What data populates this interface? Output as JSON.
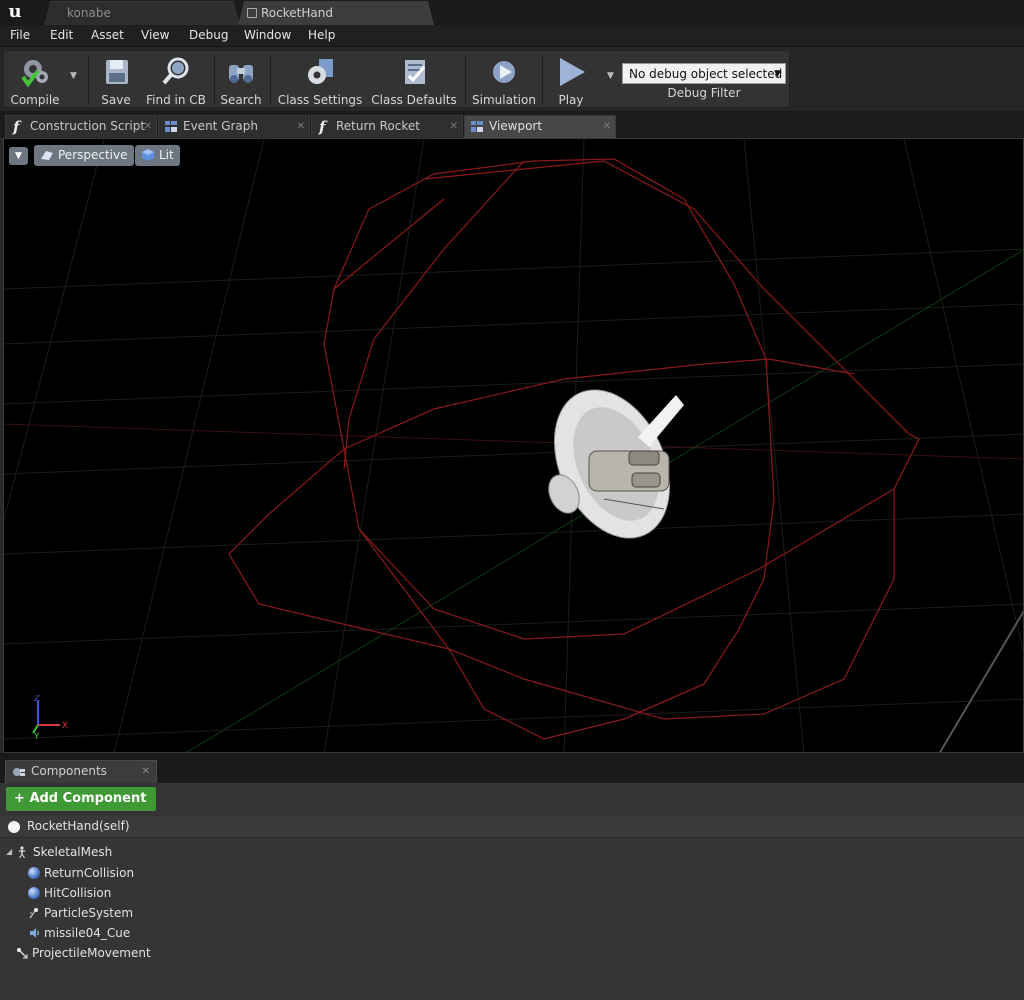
{
  "doc_tabs": [
    {
      "label": "konabe",
      "active": false
    },
    {
      "label": "RocketHand",
      "active": true
    }
  ],
  "menu": [
    "File",
    "Edit",
    "Asset",
    "View",
    "Debug",
    "Window",
    "Help"
  ],
  "toolbar": {
    "compile": "Compile",
    "save": "Save",
    "find_in_cb": "Find in CB",
    "search": "Search",
    "class_settings": "Class Settings",
    "class_defaults": "Class Defaults",
    "simulation": "Simulation",
    "play": "Play",
    "debug_object": "No debug object selected",
    "debug_filter": "Debug Filter"
  },
  "editor_tabs": [
    {
      "label": "Construction Script",
      "icon": "function-icon"
    },
    {
      "label": "Event Graph",
      "icon": "graph-icon"
    },
    {
      "label": "Return Rocket",
      "icon": "function-icon"
    },
    {
      "label": "Viewport",
      "icon": "graph-icon",
      "active": true
    }
  ],
  "viewport": {
    "view_mode": "Perspective",
    "lighting": "Lit",
    "axis_labels": {
      "x": "X",
      "y": "Y",
      "z": "Z"
    }
  },
  "components": {
    "tab_label": "Components",
    "add_button": "Add Component",
    "self_label": "RocketHand(self)",
    "tree": [
      {
        "label": "SkeletalMesh",
        "icon": "skeleton-icon",
        "level": 0
      },
      {
        "label": "ReturnCollision",
        "icon": "sphere-collision-icon",
        "level": 1
      },
      {
        "label": "HitCollision",
        "icon": "sphere-collision-icon",
        "level": 1
      },
      {
        "label": "ParticleSystem",
        "icon": "particle-icon",
        "level": 1
      },
      {
        "label": "missile04_Cue",
        "icon": "sound-cue-icon",
        "level": 1
      },
      {
        "label": "ProjectileMovement",
        "icon": "projectile-movement-icon",
        "level": 0
      }
    ]
  },
  "colors": {
    "add_component": "#3f9a36",
    "collision_wire": "#8b1a1a",
    "viewport_bg": "#000000"
  }
}
